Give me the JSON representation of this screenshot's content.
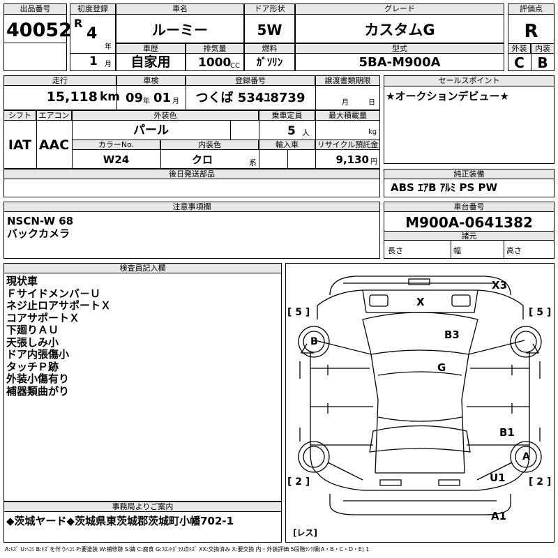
{
  "lot": {
    "label": "出品番号",
    "value": "40052"
  },
  "first_reg": {
    "label": "初度登録",
    "era": "R",
    "year": "4",
    "year_unit": "年",
    "month": "1",
    "month_unit": "月"
  },
  "car_name": {
    "label": "車名",
    "value": "ルーミー"
  },
  "door": {
    "label": "ドア形状",
    "value": "5W"
  },
  "grade": {
    "label": "グレード",
    "value": "カスタムG"
  },
  "score": {
    "label": "評価点",
    "value": "R"
  },
  "history": {
    "label": "車歴",
    "value": "自家用"
  },
  "displacement": {
    "label": "排気量",
    "value": "1000",
    "unit": "CC"
  },
  "fuel": {
    "label": "燃料",
    "value": "ｶﾞｿﾘﾝ"
  },
  "model_code": {
    "label": "型式",
    "value": "5BA-M900A"
  },
  "ext_score": {
    "label": "外装",
    "value": "C"
  },
  "int_score": {
    "label": "内装",
    "value": "B"
  },
  "mileage": {
    "label": "走行",
    "value": "15,118",
    "unit": "km"
  },
  "inspection": {
    "label": "車検",
    "year": "09",
    "year_unit": "年",
    "month": "01",
    "month_unit": "月"
  },
  "plate": {
    "label": "登録番号",
    "value": "つくば 534ﾕ8739"
  },
  "transfer": {
    "label": "譲渡書類期限",
    "month_unit": "月",
    "day_unit": "日"
  },
  "sales_point": {
    "label": "セールスポイント",
    "text": "★オークションデビュー★"
  },
  "shift": {
    "label": "シフト",
    "value": "IAT"
  },
  "aircon": {
    "label": "エアコン",
    "value": "AAC"
  },
  "ext_color": {
    "label": "外装色",
    "value": "パール"
  },
  "capacity": {
    "label": "乗車定員",
    "value": "5",
    "unit": "人"
  },
  "max_load": {
    "label": "最大積載量",
    "unit": "kg"
  },
  "color_no": {
    "label": "カラーNo.",
    "value": "W24"
  },
  "int_color": {
    "label": "内装色",
    "value": "クロ",
    "unit": "系"
  },
  "import": {
    "label": "輸入車"
  },
  "recycle": {
    "label": "リサイクル預託金",
    "value": "9,130",
    "unit": "円"
  },
  "later_parts": {
    "label": "後日発送部品"
  },
  "equipment": {
    "label": "純正装備",
    "value": "ABS ｴｱB ｱﾙﾐ PS PW"
  },
  "notes": {
    "label": "注意事項欄",
    "lines": [
      "NSCN-W 68",
      "バックカメラ"
    ]
  },
  "chassis": {
    "label": "車台番号",
    "value": "M900A-0641382"
  },
  "specs": {
    "label": "諸元",
    "length": "長さ",
    "width": "幅",
    "height": "高さ"
  },
  "inspector": {
    "label": "検査員記入欄",
    "lines": [
      "現状車",
      "Ｆサイドメンバ－Ｕ",
      "ネジ止ロアサポートＸ",
      "コアサポートＸ",
      "下廻りＡＵ",
      "天張しみ小",
      "ドア内張傷小",
      "タッチＰ跡",
      "外装小傷有り",
      "補器類曲がり"
    ]
  },
  "office": {
    "label": "事務局よりご案内",
    "value": "◆茨城ヤード◆茨城県東茨城郡茨城町小幡702-1"
  },
  "diagram": {
    "marks": {
      "x3": "X3",
      "x": "X",
      "b3": "B3",
      "g": "G",
      "b1": "B1",
      "u1": "U1",
      "a1": "A1",
      "b": "B",
      "a": "A"
    },
    "brackets": {
      "tl": "[ 5 ]",
      "tr": "[ 5 ]",
      "bl": "[ 2 ]",
      "br": "[ 2 ]",
      "rear": "[レス]"
    }
  },
  "legend": "A:ｷｽﾞ U:ﾍｺﾐ B:ｷｽﾞを伴うﾍｺﾐ P:要塗装 W:補修跡 S:錆 C:腐食 G:ﾌﾛﾝﾄｶﾞﾗｽ点ｷｽﾞ XX:交換済み X:要交換  内・外装評価 5段階ﾗﾝｸ順(A・B・C・D・E) 1"
}
